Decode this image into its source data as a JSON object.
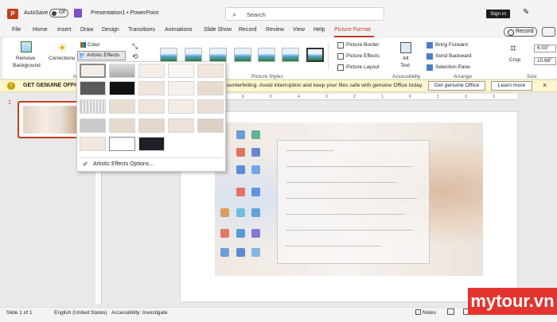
{
  "title_bar": {
    "logo_letter": "P",
    "autosave_label": "AutoSave",
    "autosave_state": "Off",
    "document_title": "Presentation1 • PowerPoint",
    "search_placeholder": "Search",
    "sign_in_label": "Sign in"
  },
  "tabs": [
    {
      "label": "File",
      "active": false
    },
    {
      "label": "Home",
      "active": false
    },
    {
      "label": "Insert",
      "active": false
    },
    {
      "label": "Draw",
      "active": false
    },
    {
      "label": "Design",
      "active": false
    },
    {
      "label": "Transitions",
      "active": false
    },
    {
      "label": "Animations",
      "active": false
    },
    {
      "label": "Slide Show",
      "active": false
    },
    {
      "label": "Record",
      "active": false
    },
    {
      "label": "Review",
      "active": false
    },
    {
      "label": "View",
      "active": false
    },
    {
      "label": "Help",
      "active": false
    },
    {
      "label": "Picture Format",
      "active": true
    }
  ],
  "record_button": "Record",
  "ribbon": {
    "remove_background": [
      "Remove",
      "Background"
    ],
    "corrections": "Corrections",
    "color": "Color",
    "artistic_effects": "Artistic Effects",
    "adjust_group_partial": "Ad",
    "picture_styles_group": "Picture Styles",
    "picture_border": "Picture Border",
    "picture_effects": "Picture Effects",
    "picture_layout": "Picture Layout",
    "alt_text": [
      "Alt",
      "Text"
    ],
    "accessibility_group": "Accessibility",
    "bring_forward": "Bring Forward",
    "send_backward": "Send Backward",
    "selection_pane": "Selection Pane",
    "arrange_group": "Arrange",
    "crop": "Crop",
    "height_value": "6.03\"",
    "width_value": "10.66\"",
    "size_group": "Size"
  },
  "notification": {
    "title": "GET GENUINE OFFICE",
    "message": "ounterfeiting. Avoid interruption and keep your files safe with genuine Office today.",
    "primary_button": "Get genuine Office",
    "secondary_button": "Learn more"
  },
  "slide_panel": {
    "slide_number": "1"
  },
  "ruler_labels": [
    "6",
    "5",
    "4",
    "3",
    "2",
    "1",
    "0",
    "1",
    "2",
    "3",
    "4",
    "5",
    "6"
  ],
  "artistic_menu": {
    "option_label": "Artistic Effects Options..."
  },
  "status_bar": {
    "slide_info": "Slide 1 of 1",
    "language": "English (United States)",
    "accessibility": "Accessibility: Investigate",
    "notes": "Notes"
  },
  "watermark": "mytour.vn"
}
